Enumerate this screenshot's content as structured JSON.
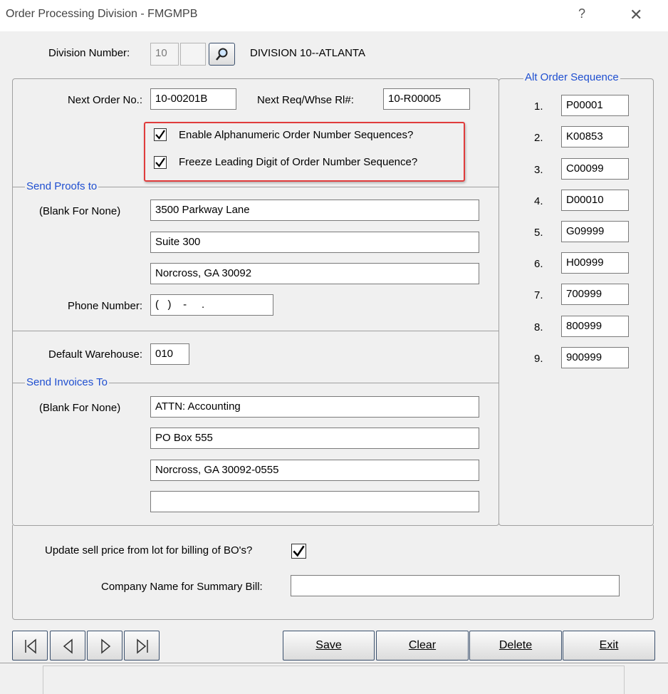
{
  "window": {
    "title": "Order Processing Division - FMGMPB",
    "help_glyph": "?",
    "close_glyph": "✕"
  },
  "division": {
    "label": "Division Number:",
    "value": "10",
    "name": "DIVISION 10--ATLANTA"
  },
  "order": {
    "next_order_label": "Next Order No.:",
    "next_order_value": "10-00201B",
    "next_req_label": "Next Req/Whse Rl#:",
    "next_req_value": "10-R00005",
    "enable_alpha_label": "Enable Alphanumeric Order Number Sequences?",
    "enable_alpha_checked": true,
    "freeze_digit_label": "Freeze Leading Digit of Order Number Sequence?",
    "freeze_digit_checked": true
  },
  "proofs": {
    "legend": "Send Proofs to",
    "blank_label": "(Blank For None)",
    "lines": [
      "3500 Parkway Lane",
      "Suite 300",
      "Norcross, GA 30092"
    ],
    "phone_label": "Phone Number:",
    "phone_value": "(   )    -     ."
  },
  "warehouse": {
    "label": "Default Warehouse:",
    "value": "010"
  },
  "invoices": {
    "legend": "Send Invoices To",
    "blank_label": "(Blank For None)",
    "lines": [
      "ATTN: Accounting",
      "PO Box 555",
      "Norcross, GA 30092-0555",
      ""
    ]
  },
  "alt_sequence": {
    "legend": "Alt Order Sequence",
    "items": [
      {
        "num": "1.",
        "value": "P00001"
      },
      {
        "num": "2.",
        "value": "K00853"
      },
      {
        "num": "3.",
        "value": "C00099"
      },
      {
        "num": "4.",
        "value": "D00010"
      },
      {
        "num": "5.",
        "value": "G09999"
      },
      {
        "num": "6.",
        "value": "H00999"
      },
      {
        "num": "7.",
        "value": "700999"
      },
      {
        "num": "8.",
        "value": "800999"
      },
      {
        "num": "9.",
        "value": "900999"
      }
    ]
  },
  "bottom": {
    "update_sell_label": "Update sell price from lot for billing of BO's?",
    "update_sell_checked": true,
    "company_label": "Company Name for Summary Bill:",
    "company_value": ""
  },
  "buttons": {
    "save": "Save",
    "clear": "Clear",
    "delete": "Delete",
    "exit": "Exit"
  },
  "icons": {
    "search": "magnifier-icon",
    "first": "first-record-icon",
    "prev": "prev-record-icon",
    "next": "next-record-icon",
    "last": "last-record-icon",
    "check": "checkmark-icon"
  }
}
